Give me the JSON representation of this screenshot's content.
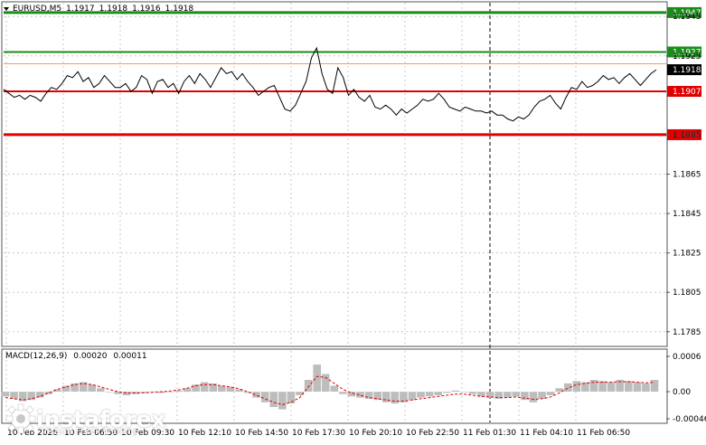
{
  "header": {
    "symbol": "EURUSD,M5",
    "open": "1.1917",
    "high": "1.1918",
    "low": "1.1916",
    "close": "1.1918"
  },
  "macd": {
    "title": "MACD(12,26,9)",
    "main": "0.00020",
    "signal": "0.00011",
    "scale": [
      "0.0006",
      "0.00",
      "-0.00046"
    ]
  },
  "price_scale": [
    "1.1945",
    "1.1925",
    "1.1885",
    "1.1865",
    "1.1845",
    "1.1825",
    "1.1805",
    "1.1785"
  ],
  "levels": [
    {
      "price": "1.1947",
      "color": "#1a8c1a",
      "kind": "target-buy"
    },
    {
      "price": "1.1927",
      "color": "#1a8c1a",
      "kind": "entry-buy"
    },
    {
      "price": "1.1907",
      "color": "#e00000",
      "kind": "entry-sell"
    },
    {
      "price": "1.1885",
      "color": "#e00000",
      "kind": "target-sell"
    }
  ],
  "current_price": "1.1918",
  "time_axis": [
    "10 Feb 2026",
    "10 Feb 06:50",
    "10 Feb 09:30",
    "10 Feb 12:10",
    "10 Feb 14:50",
    "10 Feb 17:30",
    "10 Feb 20:10",
    "10 Feb 22:50",
    "11 Feb 01:30",
    "11 Feb 04:10",
    "11 Feb 06:50"
  ],
  "logo": {
    "name": "instaforex",
    "tagline": "Instant Forex Trading"
  },
  "colors": {
    "buy": "#1a8c1a",
    "sell": "#e00000",
    "signal": "#e00000",
    "histogram": "#bdbdbd",
    "price": "#000000"
  },
  "chart_data": {
    "type": "line",
    "title": "EURUSD,M5",
    "y_range": [
      1.1778,
      1.1952
    ],
    "price_series": [
      1.1908,
      1.1906,
      1.1904,
      1.1905,
      1.1903,
      1.1905,
      1.1904,
      1.1902,
      1.1906,
      1.1909,
      1.1908,
      1.1911,
      1.1915,
      1.1914,
      1.1917,
      1.1912,
      1.1914,
      1.1909,
      1.1911,
      1.1915,
      1.1912,
      1.1909,
      1.1909,
      1.1911,
      1.1907,
      1.1909,
      1.1915,
      1.1913,
      1.1906,
      1.1912,
      1.1913,
      1.1909,
      1.1911,
      1.1906,
      1.1912,
      1.1915,
      1.1911,
      1.1916,
      1.1913,
      1.1909,
      1.1914,
      1.1919,
      1.1916,
      1.1917,
      1.1913,
      1.1916,
      1.1912,
      1.1909,
      1.1905,
      1.1907,
      1.1909,
      1.191,
      1.1904,
      1.1898,
      1.1897,
      1.19,
      1.1906,
      1.1912,
      1.1924,
      1.1929,
      1.1916,
      1.1908,
      1.1906,
      1.1919,
      1.1914,
      1.1905,
      1.1908,
      1.1904,
      1.1902,
      1.1905,
      1.1899,
      1.1898,
      1.19,
      1.1898,
      1.1895,
      1.1898,
      1.1896,
      1.1898,
      1.19,
      1.1903,
      1.1902,
      1.1903,
      1.1906,
      1.1903,
      1.1899,
      1.1898,
      1.1897,
      1.1899,
      1.1898,
      1.1897,
      1.1897,
      1.1896,
      1.1897,
      1.1895,
      1.1895,
      1.1893,
      1.1892,
      1.1894,
      1.1893,
      1.1895,
      1.1899,
      1.1902,
      1.1903,
      1.1905,
      1.1901,
      1.1898,
      1.1904,
      1.1909,
      1.1908,
      1.1912,
      1.1909,
      1.191,
      1.1912,
      1.1915,
      1.1913,
      1.1914,
      1.1911,
      1.1914,
      1.1916,
      1.1913,
      1.191,
      1.1913,
      1.1916,
      1.1918
    ],
    "macd_histogram": [
      -8e-05,
      -0.00012,
      -0.00016,
      -0.00014,
      -0.0001,
      -4e-05,
      4e-05,
      0.0001,
      0.00014,
      0.00016,
      0.00012,
      6e-05,
      0.0,
      -4e-05,
      -6e-05,
      -4e-05,
      -2e-05,
      0.0,
      -2e-05,
      0.0,
      2e-05,
      6e-05,
      0.00012,
      0.00016,
      0.00014,
      0.0001,
      8e-05,
      4e-05,
      -2e-05,
      -0.0001,
      -0.00018,
      -0.00026,
      -0.0003,
      -0.0002,
      -6e-05,
      0.0002,
      0.00046,
      0.0003,
      0.0001,
      -4e-05,
      -8e-05,
      -0.0001,
      -0.00012,
      -0.00014,
      -0.00018,
      -0.0002,
      -0.00018,
      -0.00014,
      -0.0001,
      -8e-05,
      -6e-05,
      -2e-05,
      2e-05,
      0.0,
      -4e-05,
      -8e-05,
      -0.0001,
      -0.00012,
      -0.0001,
      -8e-05,
      -0.00014,
      -0.00018,
      -0.00012,
      -6e-05,
      6e-05,
      0.00014,
      0.00018,
      0.00016,
      0.0002,
      0.00018,
      0.00016,
      0.0002,
      0.00018,
      0.00016,
      0.00014,
      0.0002
    ],
    "macd_signal": [
      -0.0001,
      -0.00012,
      -0.00014,
      -0.00012,
      -8e-05,
      -2e-05,
      4e-05,
      8e-05,
      0.00012,
      0.00014,
      0.00012,
      8e-05,
      4e-05,
      0.0,
      -2e-05,
      -2e-05,
      -2e-05,
      -1e-05,
      0.0,
      1e-05,
      3e-05,
      6e-05,
      0.0001,
      0.00012,
      0.00012,
      0.0001,
      8e-05,
      5e-05,
      0.0,
      -6e-05,
      -0.00012,
      -0.00018,
      -0.00022,
      -0.00018,
      -0.0001,
      8e-05,
      0.00026,
      0.00024,
      0.00014,
      4e-05,
      -2e-05,
      -6e-05,
      -0.0001,
      -0.00012,
      -0.00014,
      -0.00016,
      -0.00016,
      -0.00014,
      -0.00012,
      -0.0001,
      -8e-05,
      -6e-05,
      -4e-05,
      -4e-05,
      -6e-05,
      -8e-05,
      -9e-05,
      -0.0001,
      -0.0001,
      -9e-05,
      -0.00011,
      -0.00013,
      -0.00012,
      -9e-05,
      -2e-05,
      6e-05,
      0.00012,
      0.00014,
      0.00016,
      0.00016,
      0.00016,
      0.00017,
      0.00017,
      0.00016,
      0.00015,
      0.00016
    ],
    "macd_range": [
      -0.00046,
      0.0006
    ]
  }
}
